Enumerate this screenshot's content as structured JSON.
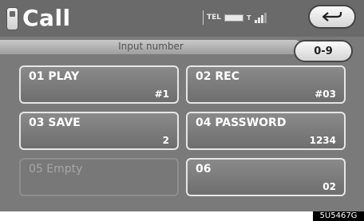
{
  "header": {
    "title": "Call",
    "status": {
      "tel_label": "TEL",
      "signal_label": "T",
      "signal_level": 3
    }
  },
  "input": {
    "placeholder": "Input number"
  },
  "keypad_button": {
    "label": "0-9"
  },
  "entries": [
    {
      "name": "01 PLAY",
      "number": "#1",
      "enabled": true
    },
    {
      "name": "02 REC",
      "number": "#03",
      "enabled": true
    },
    {
      "name": "03 SAVE",
      "number": "2",
      "enabled": true
    },
    {
      "name": "04 PASSWORD",
      "number": "1234",
      "enabled": true
    },
    {
      "name": "05 Empty",
      "number": "",
      "enabled": false
    },
    {
      "name": "06",
      "number": "02",
      "enabled": true
    }
  ],
  "watermark": "5U5467G"
}
